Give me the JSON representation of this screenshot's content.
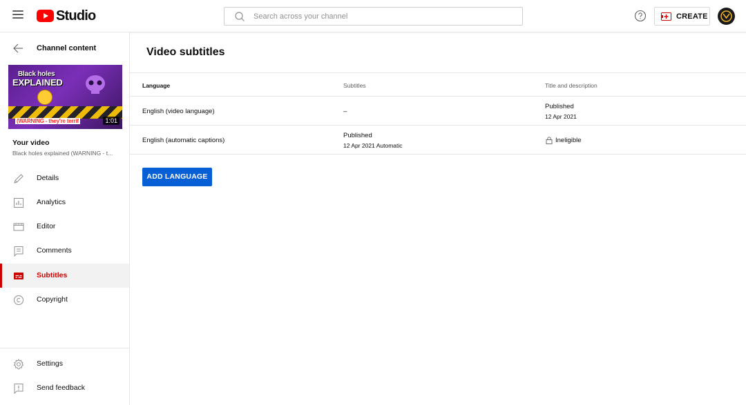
{
  "header": {
    "logo_text": "Studio",
    "search": {
      "placeholder": "Search across your channel",
      "value": ""
    },
    "create_label": "CREATE"
  },
  "sidebar": {
    "back_label": "Channel content",
    "thumbnail": {
      "line1": "Black holes",
      "line2": "EXPLAINED",
      "warning": "(WARNING - they're terrif",
      "duration": "1:01"
    },
    "your_video_label": "Your video",
    "video_title": "Black holes explained (WARNING - t...",
    "items": [
      {
        "label": "Details",
        "icon": "pencil-icon",
        "active": false
      },
      {
        "label": "Analytics",
        "icon": "analytics-icon",
        "active": false
      },
      {
        "label": "Editor",
        "icon": "editor-icon",
        "active": false
      },
      {
        "label": "Comments",
        "icon": "comments-icon",
        "active": false
      },
      {
        "label": "Subtitles",
        "icon": "subtitles-icon",
        "active": true
      },
      {
        "label": "Copyright",
        "icon": "copyright-icon",
        "active": false
      }
    ],
    "footer_items": [
      {
        "label": "Settings",
        "icon": "gear-icon"
      },
      {
        "label": "Send feedback",
        "icon": "feedback-icon"
      }
    ]
  },
  "main": {
    "title": "Video subtitles",
    "columns": [
      "Language",
      "Subtitles",
      "Title and description"
    ],
    "rows": [
      {
        "language": "English (video language)",
        "subtitles": {
          "status": "–",
          "detail": ""
        },
        "title_desc": {
          "status": "Published",
          "detail": "12 Apr 2021"
        }
      },
      {
        "language": "English (automatic captions)",
        "subtitles": {
          "status": "Published",
          "detail": "12 Apr 2021 Automatic"
        },
        "title_desc": {
          "status": "Ineligible",
          "detail": ""
        }
      }
    ],
    "add_language_label": "ADD LANGUAGE"
  },
  "colors": {
    "accent_red": "#cc0000",
    "primary_blue": "#065fd4",
    "youtube_red": "#ff0000"
  }
}
